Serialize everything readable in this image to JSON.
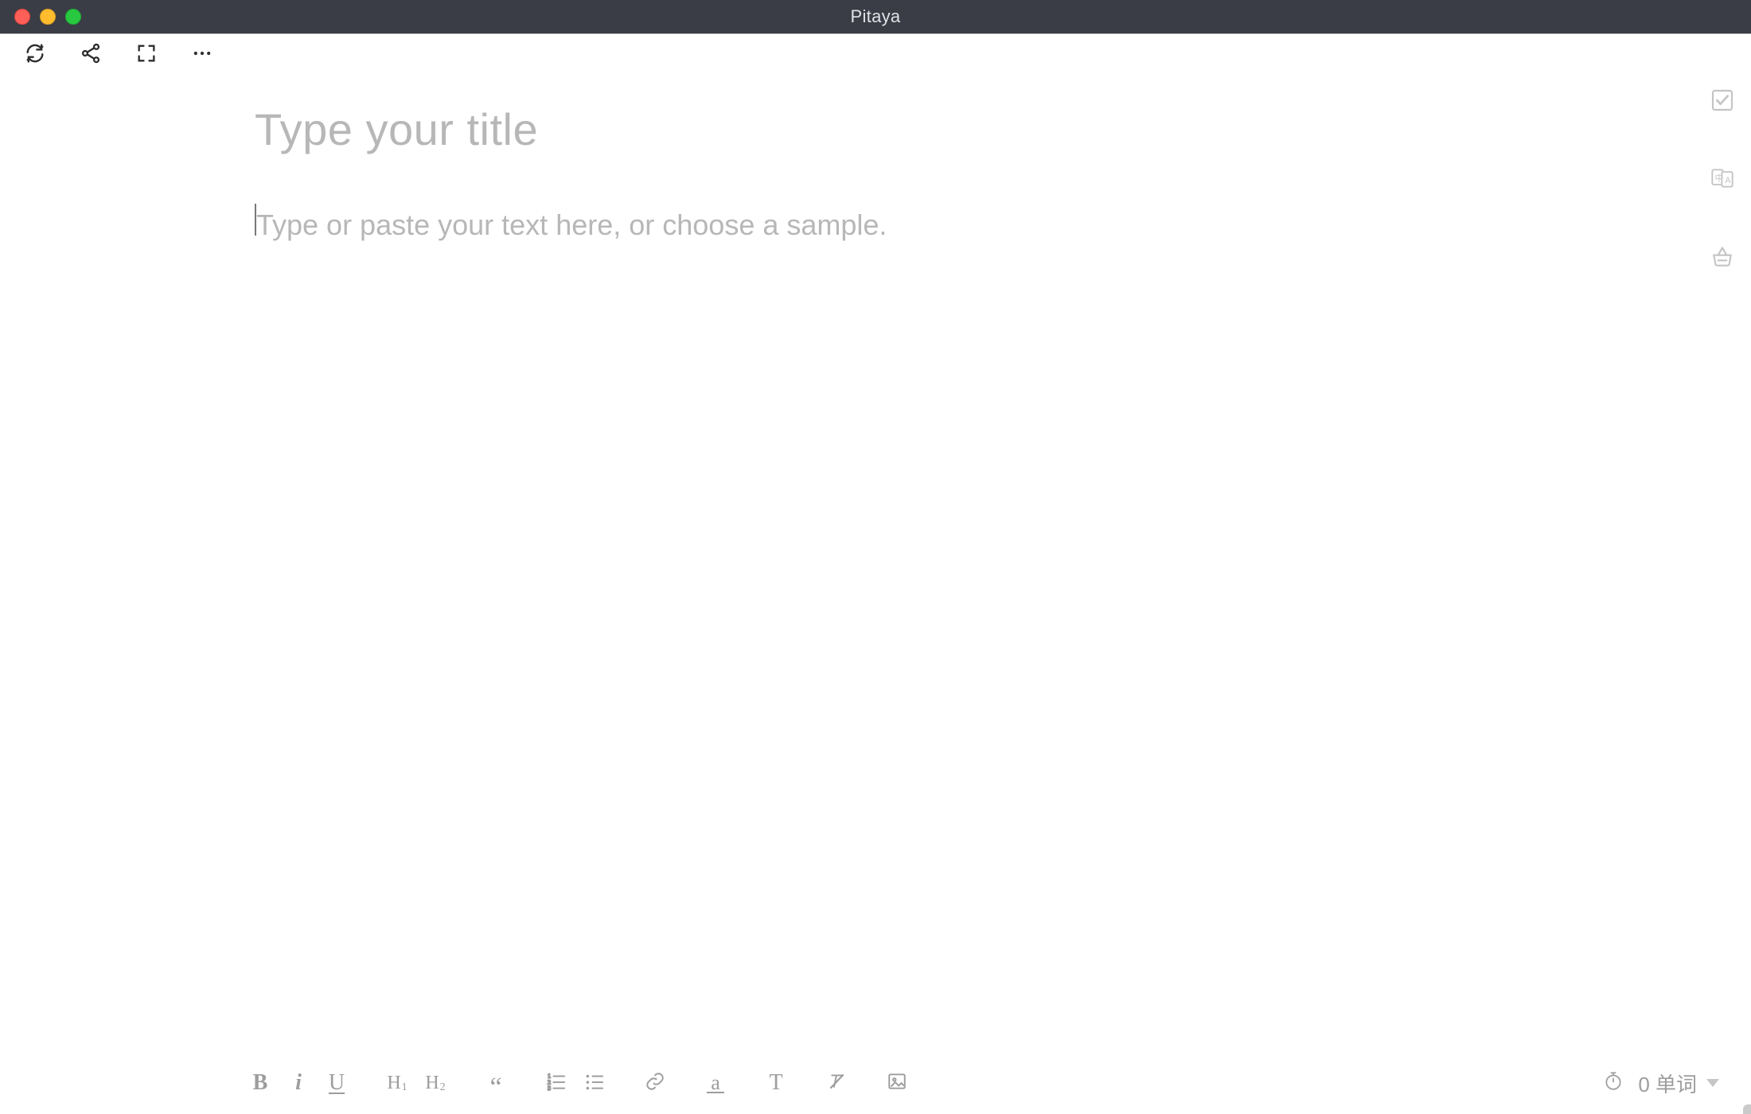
{
  "window": {
    "title": "Pitaya"
  },
  "toolbar": {
    "refresh": "refresh",
    "share": "share",
    "expand": "expand",
    "more": "more"
  },
  "side": {
    "check": "check",
    "translate": "translate",
    "basket": "basket"
  },
  "editor": {
    "title_placeholder": "Type your title",
    "body_placeholder": "Type or paste your text here, or choose a sample.",
    "title_value": "",
    "body_value": ""
  },
  "format": {
    "bold": "B",
    "italic": "i",
    "underline": "U",
    "h1": "H",
    "h1_sub": "1",
    "h2": "H",
    "h2_sub": "2",
    "quote": "“",
    "ol": "ordered-list",
    "ul": "unordered-list",
    "link": "link",
    "lettercase": "a",
    "text_t": "T",
    "clear_format": "clear",
    "image": "image"
  },
  "status": {
    "timer": "timer",
    "word_count": "0 单词"
  }
}
